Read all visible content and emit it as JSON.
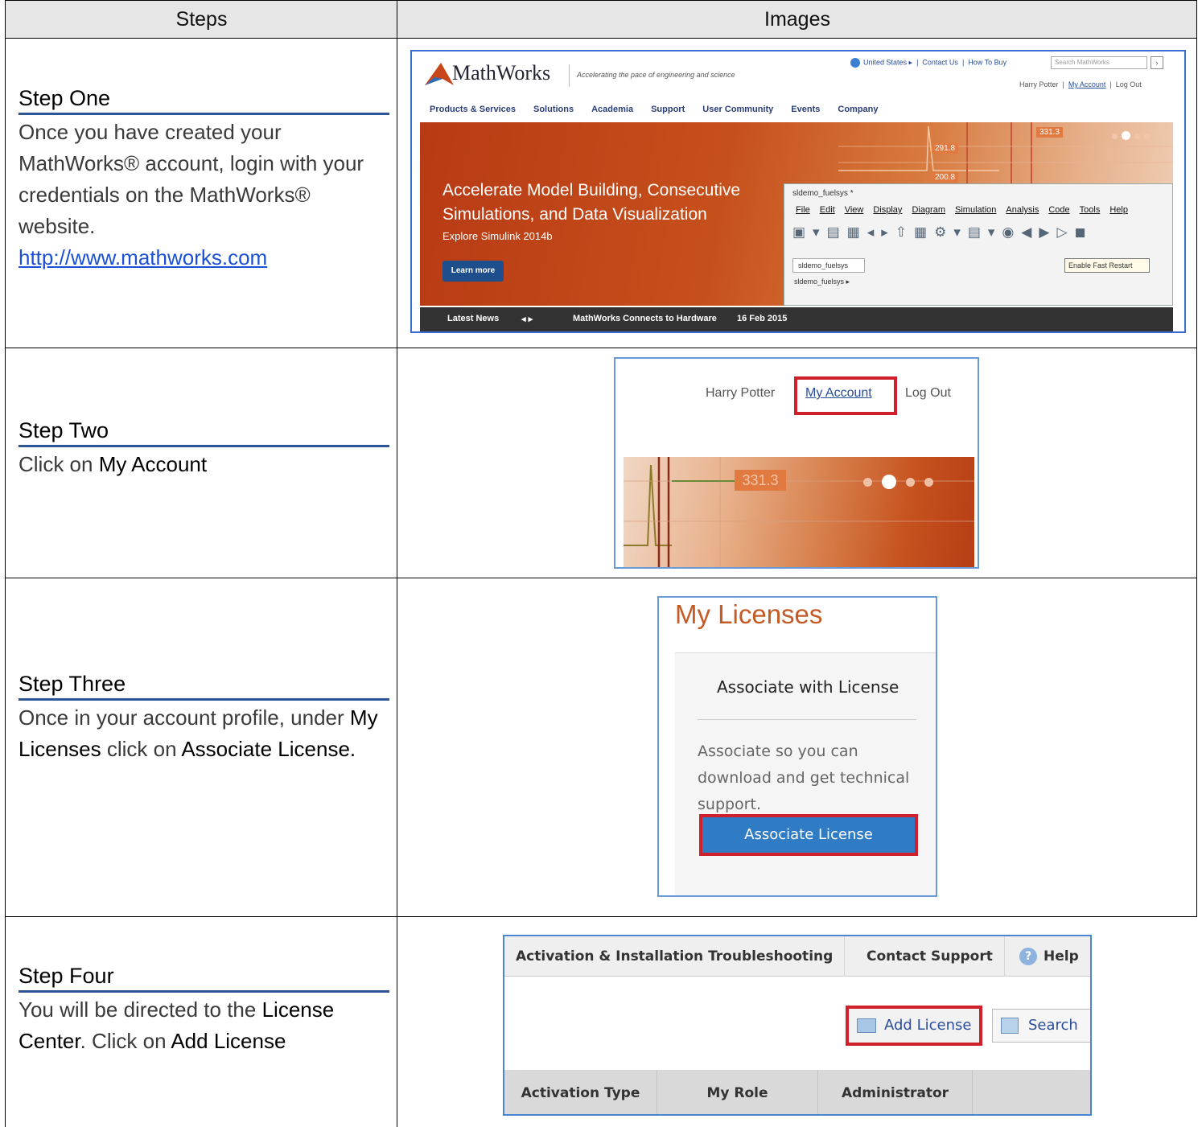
{
  "header": {
    "steps": "Steps",
    "images": "Images"
  },
  "step1": {
    "title": "Step One",
    "text": "Once you have created your MathWorks® account, login with your credentials on the MathWorks® website.",
    "link": "http://www.mathworks.com",
    "shot": {
      "brand": "MathWorks",
      "tagline": "Accelerating the pace of engineering and science",
      "country": "United States ▸",
      "contact": "Contact Us",
      "buy": "How To Buy",
      "search_placeholder": "Search MathWorks",
      "user": "Harry Potter",
      "account": "My Account",
      "logout": "Log Out",
      "nav": [
        "Products & Services",
        "Solutions",
        "Academia",
        "Support",
        "User Community",
        "Events",
        "Company"
      ],
      "banner_title": "Accelerate Model Building, Consecutive Simulations, and Data Visualization",
      "banner_sub": "Explore Simulink 2014b",
      "banner_btn": "Learn more",
      "values": [
        "291.8",
        "200.8",
        "331.3"
      ],
      "sim_title": "sldemo_fuelsys *",
      "sim_menu": [
        "File",
        "Edit",
        "View",
        "Display",
        "Diagram",
        "Simulation",
        "Analysis",
        "Code",
        "Tools",
        "Help"
      ],
      "sim_tab": "sldemo_fuelsys",
      "sim_crumb": "sldemo_fuelsys ▸",
      "tooltip": "Enable Fast Restart",
      "news_label": "Latest News",
      "news_arrows": "◂ ▸",
      "news_item": "MathWorks Connects to Hardware",
      "news_date": "16 Feb 2015"
    }
  },
  "step2": {
    "title": "Step Two",
    "text_pre": "Click on ",
    "text_kw": "My Account",
    "shot": {
      "user": "Harry Potter",
      "account": "My Account",
      "logout": "Log Out",
      "value": "331.3"
    }
  },
  "step3": {
    "title": "Step Three",
    "text_pre": "Once in your account profile, under ",
    "kw1": "My Licenses",
    "text_mid": " click on ",
    "kw2": "Associate License.",
    "shot": {
      "heading": "My Licenses",
      "card_title": "Associate with License",
      "desc": "Associate so you can download and get technical support.",
      "button": "Associate License"
    }
  },
  "step4": {
    "title": "Step Four",
    "text_pre": "You will be directed to the ",
    "kw1": "License Center",
    "text_mid": ".  Click on ",
    "kw2": "Add License",
    "shot": {
      "tabs": [
        "Activation & Installation Troubleshooting",
        "Contact Support",
        "Help"
      ],
      "add": "Add License",
      "search": "Search",
      "columns": [
        "Activation Type",
        "My Role",
        "Administrator"
      ]
    }
  },
  "colors": {
    "title_rule": "#2f5496",
    "highlight": "#d0202c",
    "link": "#1a4fd6"
  }
}
